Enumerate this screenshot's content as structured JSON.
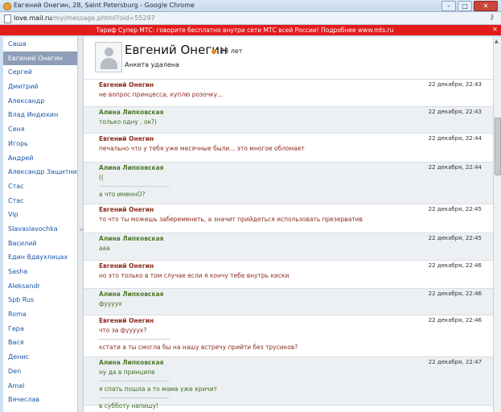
{
  "window": {
    "title": "Евгений Онегин, 28, Saint Petersburg - Google Chrome"
  },
  "address": {
    "host": "love.mail.ru",
    "path": "/my/message.phtml?oid=55297"
  },
  "banner": {
    "text": "Тариф Супер МТС: говорите бесплатно внутри сети МТС всей России! Подробнее www.mts.ru"
  },
  "sidebar": {
    "items": [
      {
        "label": "Саша"
      },
      {
        "label": "Евгений Онегин",
        "active": true
      },
      {
        "label": "Сергей"
      },
      {
        "label": "Дмитрий"
      },
      {
        "label": "Александр"
      },
      {
        "label": "Влад Индюхин"
      },
      {
        "label": "Сеня"
      },
      {
        "label": "Игорь"
      },
      {
        "label": "Андрей"
      },
      {
        "label": "Александр Защитник"
      },
      {
        "label": "Стас"
      },
      {
        "label": "Стас"
      },
      {
        "label": "Vip"
      },
      {
        "label": "Slavaslavochka"
      },
      {
        "label": "Василий"
      },
      {
        "label": "Един Вдвухлицах"
      },
      {
        "label": "Sasha"
      },
      {
        "label": "Aleksandr"
      },
      {
        "label": "Spb Rus"
      },
      {
        "label": "Roma"
      },
      {
        "label": "Гера"
      },
      {
        "label": "Вася"
      },
      {
        "label": "Денис"
      },
      {
        "label": "Den"
      },
      {
        "label": "Amal"
      },
      {
        "label": "Вячеслав"
      }
    ]
  },
  "profile": {
    "name": "Евгений Онегин",
    "age": "28 лет",
    "status": "Анкета удалена"
  },
  "messages": [
    {
      "author": "Евгений Онегин",
      "dir": "in",
      "time": "22 декабря, 22:43",
      "lines": [
        "не вопрос принцесса, куплю розочку..."
      ]
    },
    {
      "author": "Алина Липковская",
      "dir": "out",
      "time": "22 декабря, 22:43",
      "lines": [
        "только одну , ок?)"
      ]
    },
    {
      "author": "Евгений Онегин",
      "dir": "in",
      "time": "22 декабря, 22:44",
      "lines": [
        "печально что у тебя уже месячные были... это многое обломает"
      ]
    },
    {
      "author": "Алина Липковская",
      "dir": "out",
      "time": "22 декабря, 22:44",
      "lines": [
        "((",
        "а что именнО?"
      ]
    },
    {
      "author": "Евгений Онегин",
      "dir": "in",
      "time": "22 декабря, 22:45",
      "lines": [
        "то что ты можешь забеременеть, а значит прийдеться использовать презерватив"
      ]
    },
    {
      "author": "Алина Липковская",
      "dir": "out",
      "time": "22 декабря, 22:45",
      "lines": [
        "ааа"
      ]
    },
    {
      "author": "Евгений Онегин",
      "dir": "in",
      "time": "22 декабря, 22:46",
      "lines": [
        "но это только в том случае если я кончу тебе внутрь киски"
      ]
    },
    {
      "author": "Алина Липковская",
      "dir": "out",
      "time": "22 декабря, 22:46",
      "lines": [
        "фуууух"
      ]
    },
    {
      "author": "Евгений Онегин",
      "dir": "in",
      "time": "22 декабря, 22:46",
      "lines": [
        "что за фуууух?",
        "кстати а ты смогла бы на нашу встречу прийти без трусиков?"
      ]
    },
    {
      "author": "Алина Липковская",
      "dir": "out",
      "time": "22 декабря, 22:47",
      "lines": [
        "ну да в принципе",
        "я спать пошла а то мама уже кричит",
        "в субботу напишу!"
      ]
    }
  ]
}
